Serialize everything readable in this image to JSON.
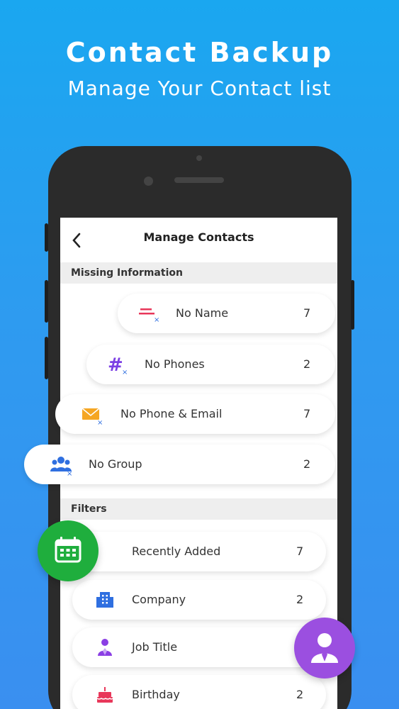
{
  "hero": {
    "title": "Contact Backup",
    "subtitle": "Manage Your Contact list"
  },
  "header": {
    "back_icon": "chevron-left-icon",
    "title": "Manage Contacts"
  },
  "missing_info": {
    "heading": "Missing Information",
    "items": [
      {
        "label": "No Name",
        "count": "7",
        "icon": "no-name-icon",
        "color": "#e8375a"
      },
      {
        "label": "No Phones",
        "count": "2",
        "icon": "hash-icon",
        "color": "#7b3fe4"
      },
      {
        "label": "No Phone & Email",
        "count": "7",
        "icon": "envelope-icon",
        "color": "#f5a623"
      },
      {
        "label": "No Group",
        "count": "2",
        "icon": "group-icon",
        "color": "#2f6fe0"
      }
    ]
  },
  "filters": {
    "heading": "Filters",
    "items": [
      {
        "label": "Recently Added",
        "count": "7",
        "icon": "calendar-icon",
        "color": "#1fae3d"
      },
      {
        "label": "Company",
        "count": "2",
        "icon": "building-icon",
        "color": "#2f6fe0"
      },
      {
        "label": "Job Title",
        "count": "",
        "icon": "person-tie-icon",
        "color": "#8b3fe4"
      },
      {
        "label": "Birthday",
        "count": "2",
        "icon": "cake-icon",
        "color": "#e8375a"
      }
    ]
  },
  "colors": {
    "background": "#2e9bf0",
    "fab_green": "#1fae3d",
    "fab_purple": "#9b4fe0"
  }
}
